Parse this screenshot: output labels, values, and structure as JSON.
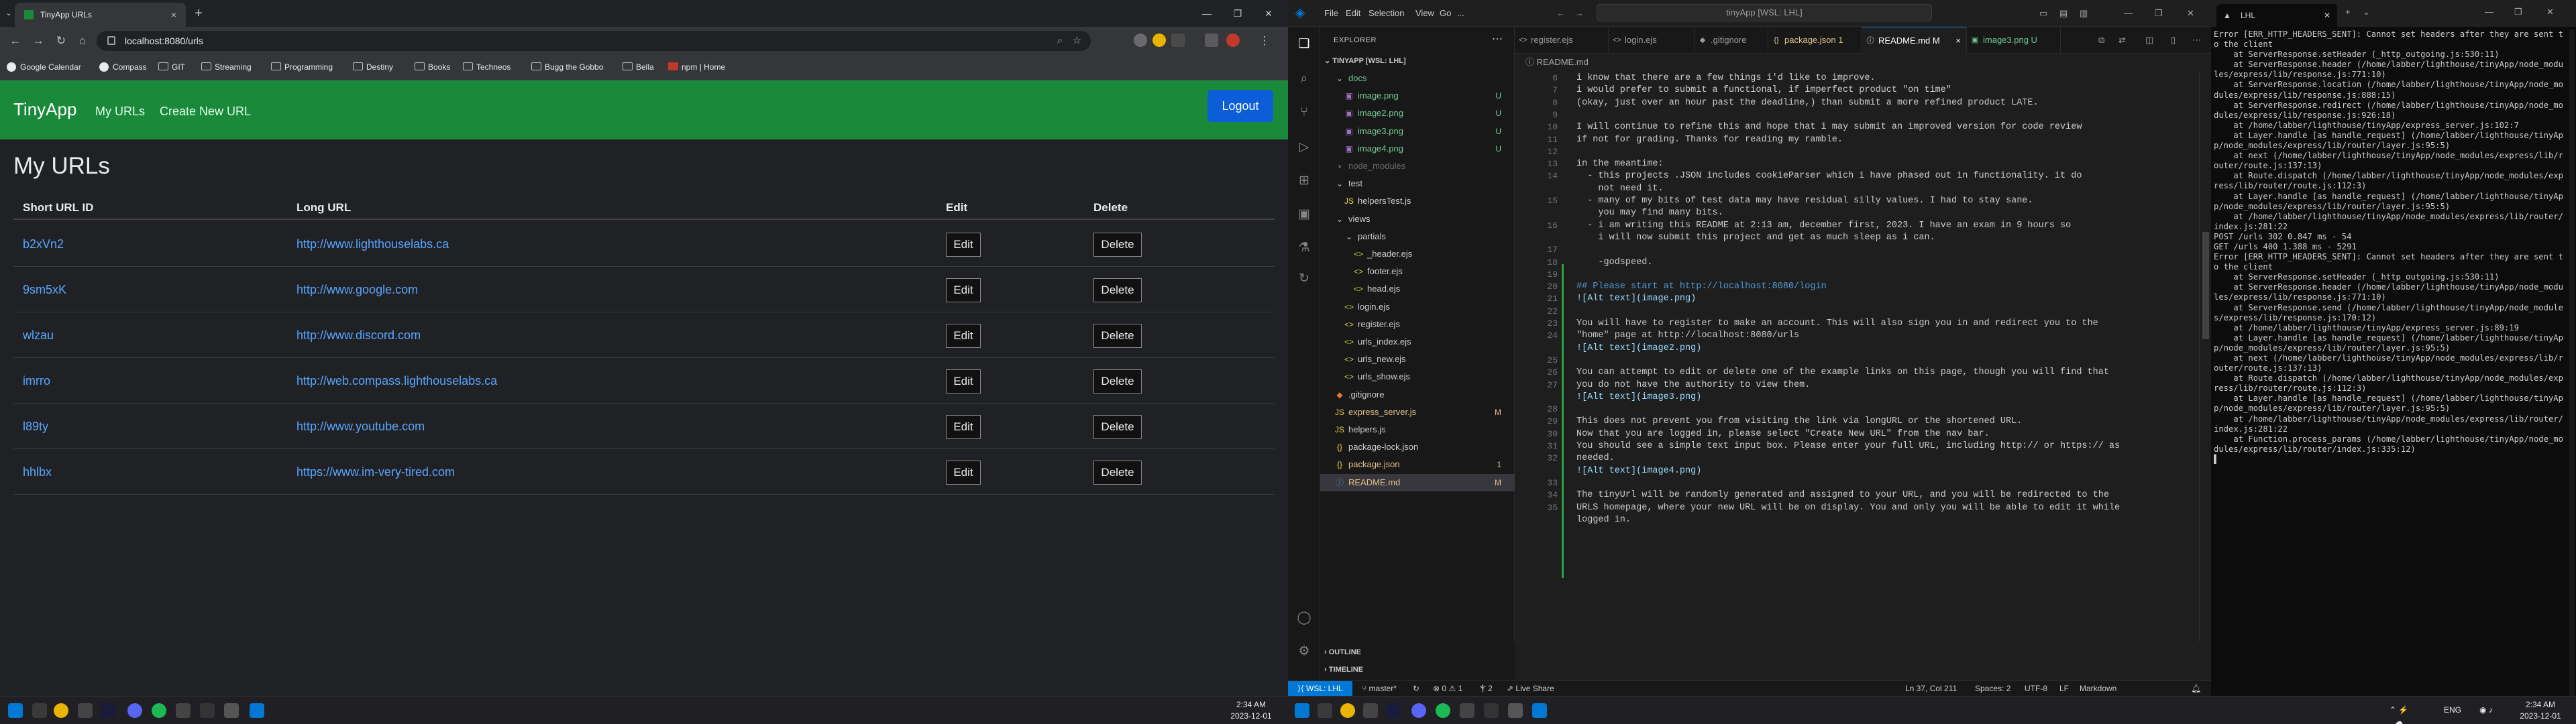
{
  "chrome": {
    "tab_title": "TinyApp URLs",
    "tab_close": "×",
    "new_tab": "+",
    "url": "localhost:8080/urls",
    "bookmarks": [
      "Google Calendar",
      "Compass",
      "GIT",
      "Streaming",
      "Programming",
      "Destiny",
      "Books",
      "Techneos",
      "Bugg the Gobbo",
      "Bella",
      "npm | Home"
    ]
  },
  "tinyapp": {
    "brand": "TinyApp",
    "nav_my_urls": "My URLs",
    "nav_create": "Create New URL",
    "logout": "Logout",
    "heading": "My URLs",
    "col_short": "Short URL ID",
    "col_long": "Long URL",
    "col_edit": "Edit",
    "col_delete": "Delete",
    "edit_label": "Edit",
    "delete_label": "Delete",
    "rows": [
      {
        "id": "b2xVn2",
        "long": "http://www.lighthouselabs.ca"
      },
      {
        "id": "9sm5xK",
        "long": "http://www.google.com"
      },
      {
        "id": "wlzau",
        "long": "http://www.discord.com"
      },
      {
        "id": "imrro",
        "long": "http://web.compass.lighthouselabs.ca"
      },
      {
        "id": "l89ty",
        "long": "http://www.youtube.com"
      },
      {
        "id": "hhlbx",
        "long": "https://www.im-very-tired.com"
      }
    ]
  },
  "taskbar": {
    "left_time": "2:34 AM",
    "left_date": "2023-12-01",
    "right_lang": "ENG",
    "right_time": "2:34 AM",
    "right_date": "2023-12-01"
  },
  "vscode": {
    "menus": [
      "File",
      "Edit",
      "Selection",
      "View",
      "Go",
      "..."
    ],
    "search": "tinyApp [WSL: LHL]",
    "explorer_label": "EXPLORER",
    "root": "TINYAPP [WSL: LHL]",
    "tree": [
      {
        "name": "docs",
        "kind": "folder",
        "badge": "",
        "indent": 1,
        "color": "#73c991"
      },
      {
        "name": "image.png",
        "kind": "img",
        "badge": "U",
        "indent": 2,
        "color": "#73c991"
      },
      {
        "name": "image2.png",
        "kind": "img",
        "badge": "U",
        "indent": 2,
        "color": "#73c991"
      },
      {
        "name": "image3.png",
        "kind": "img",
        "badge": "U",
        "indent": 2,
        "color": "#73c991"
      },
      {
        "name": "image4.png",
        "kind": "img",
        "badge": "U",
        "indent": 2,
        "color": "#73c991"
      },
      {
        "name": "node_modules",
        "kind": "folder",
        "badge": "",
        "indent": 1,
        "color": "#6b6b6b"
      },
      {
        "name": "test",
        "kind": "folder",
        "badge": "",
        "indent": 1,
        "color": "#cccccc"
      },
      {
        "name": "helpersTest.js",
        "kind": "js",
        "badge": "",
        "indent": 2,
        "color": "#cccccc"
      },
      {
        "name": "views",
        "kind": "folder",
        "badge": "",
        "indent": 1,
        "color": "#cccccc"
      },
      {
        "name": "partials",
        "kind": "folder",
        "badge": "",
        "indent": 2,
        "color": "#cccccc"
      },
      {
        "name": "_header.ejs",
        "kind": "ejs",
        "badge": "",
        "indent": 3,
        "color": "#cccccc"
      },
      {
        "name": "footer.ejs",
        "kind": "ejs",
        "badge": "",
        "indent": 3,
        "color": "#cccccc"
      },
      {
        "name": "head.ejs",
        "kind": "ejs",
        "badge": "",
        "indent": 3,
        "color": "#cccccc"
      },
      {
        "name": "login.ejs",
        "kind": "ejs",
        "badge": "",
        "indent": 2,
        "color": "#cccccc"
      },
      {
        "name": "register.ejs",
        "kind": "ejs",
        "badge": "",
        "indent": 2,
        "color": "#cccccc"
      },
      {
        "name": "urls_index.ejs",
        "kind": "ejs",
        "badge": "",
        "indent": 2,
        "color": "#cccccc"
      },
      {
        "name": "urls_new.ejs",
        "kind": "ejs",
        "badge": "",
        "indent": 2,
        "color": "#cccccc"
      },
      {
        "name": "urls_show.ejs",
        "kind": "ejs",
        "badge": "",
        "indent": 2,
        "color": "#cccccc"
      },
      {
        "name": ".gitignore",
        "kind": "git",
        "badge": "",
        "indent": 1,
        "color": "#cccccc"
      },
      {
        "name": "express_server.js",
        "kind": "js",
        "badge": "M",
        "indent": 1,
        "color": "#e2c08d"
      },
      {
        "name": "helpers.js",
        "kind": "js",
        "badge": "",
        "indent": 1,
        "color": "#cccccc"
      },
      {
        "name": "package-lock.json",
        "kind": "json",
        "badge": "",
        "indent": 1,
        "color": "#cccccc"
      },
      {
        "name": "package.json",
        "kind": "json",
        "badge": "1",
        "indent": 1,
        "color": "#e2c08d"
      },
      {
        "name": "README.md",
        "kind": "md",
        "badge": "M",
        "indent": 1,
        "color": "#e2c08d"
      }
    ],
    "tabs": [
      {
        "name": "register.ejs",
        "icon": "<>",
        "color": "#9d9d9d"
      },
      {
        "name": "login.ejs",
        "icon": "<>",
        "color": "#9d9d9d"
      },
      {
        "name": ".gitignore",
        "icon": "◆",
        "color": "#9d9d9d"
      },
      {
        "name": "package.json 1",
        "icon": "{}",
        "color": "#e2c08d"
      },
      {
        "name": "README.md M",
        "icon": "ⓘ",
        "color": "#ffffff"
      },
      {
        "name": "image3.png U",
        "icon": "▣",
        "color": "#73c991"
      }
    ],
    "tab_close": "×",
    "breadcrumb": "ⓘ README.md",
    "code_start_line": 6,
    "code": [
      {
        "t": "i know that there are a few things i'd like to improve.",
        "c": "u"
      },
      {
        "t": "i would prefer to submit a functional, if imperfect product \"on time\"",
        "c": "u"
      },
      {
        "t": "(okay, just over an hour past the deadline,) than submit a more refined product LATE.",
        "c": "u"
      },
      {
        "t": "",
        "c": "u"
      },
      {
        "t": "I will continue to refine this and hope that i may submit an improved version for code review",
        "c": "u"
      },
      {
        "t": "if not for grading. Thanks for reading my ramble.",
        "c": "u"
      },
      {
        "t": "",
        "c": "u"
      },
      {
        "t": "in the meantime:",
        "c": "u"
      },
      {
        "t": "  - this projects .JSON includes cookieParser which i have phased out in functionality. it do",
        "c": "u"
      },
      {
        "t": "    not need it.",
        "c": "u"
      },
      {
        "t": "  - many of my bits of test data may have residual silly values. I had to stay sane.",
        "c": "u"
      },
      {
        "t": "    you may find many bits.",
        "c": "u"
      },
      {
        "t": "  - i am writing this README at 2:13 am, december first, 2023. I have an exam in 9 hours so",
        "c": "u"
      },
      {
        "t": "    i will now submit this project and get as much sleep as i can.",
        "c": "u"
      },
      {
        "t": "",
        "c": "u"
      },
      {
        "t": "    -godspeed.",
        "c": "u"
      },
      {
        "t": "",
        "c": "u"
      },
      {
        "t": "## Please start at http://localhost:8080/login",
        "c": "h"
      },
      {
        "t": "![Alt text](image.png)",
        "c": "lk"
      },
      {
        "t": "",
        "c": "u"
      },
      {
        "t": "You will have to register to make an account. This will also sign you in and redirect you to the",
        "c": "u"
      },
      {
        "t": "\"home\" page at http://localhost:8080/urls",
        "c": "u"
      },
      {
        "t": "![Alt text](image2.png)",
        "c": "lk"
      },
      {
        "t": "",
        "c": "u"
      },
      {
        "t": "You can attempt to edit or delete one of the example links on this page, though you will find that",
        "c": "u"
      },
      {
        "t": "you do not have the authority to view them.",
        "c": "u"
      },
      {
        "t": "![Alt text](image3.png)",
        "c": "lk"
      },
      {
        "t": "",
        "c": "u"
      },
      {
        "t": "This does not prevent you from visiting the link via longURL or the shortened URL.",
        "c": "u"
      },
      {
        "t": "Now that you are logged in, please select \"Create New URL\" from the nav bar.",
        "c": "u"
      },
      {
        "t": "You should see a simple text input box. Please enter your full URL, including http:// or https:// as",
        "c": "u"
      },
      {
        "t": "needed.",
        "c": "u"
      },
      {
        "t": "![Alt text](image4.png)",
        "c": "lk"
      },
      {
        "t": "",
        "c": "u"
      },
      {
        "t": "The tinyUrl will be randomly generated and assigned to your URL, and you will be redirected to the",
        "c": "u"
      },
      {
        "t": "URLS homepage, where your new URL will be on display. You and only you will be able to edit it while",
        "c": "u"
      },
      {
        "t": "logged in.",
        "c": "u"
      }
    ],
    "line_numbers": [
      "6",
      "7",
      "8",
      "9",
      "10",
      "11",
      "12",
      "13",
      "14",
      "",
      "15",
      "",
      "16",
      "",
      "17",
      "18",
      "19",
      "20",
      "21",
      "22",
      "23",
      "24",
      "",
      "25",
      "26",
      "27",
      "",
      "28",
      "29",
      "30",
      "31",
      "32",
      "",
      "33",
      "34",
      "35",
      "",
      "36"
    ],
    "outline": "OUTLINE",
    "timeline": "TIMELINE",
    "status": {
      "remote": "WSL: LHL",
      "branch": "master*",
      "problems": "⊗ 0 ⚠ 1",
      "ports": "Ⲯ 2",
      "liveshare": "Live Share",
      "position": "Ln 37, Col 211",
      "spaces": "Spaces: 2",
      "encoding": "UTF-8",
      "eol": "LF",
      "lang": "Markdown"
    }
  },
  "terminal": {
    "tab_title": "LHL",
    "lines": [
      "Error [ERR_HTTP_HEADERS_SENT]: Cannot set headers after they are sent to the client",
      "    at ServerResponse.setHeader (_http_outgoing.js:530:11)",
      "    at ServerResponse.header (/home/labber/lighthouse/tinyApp/node_modules/express/lib/response.js:771:10)",
      "    at ServerResponse.location (/home/labber/lighthouse/tinyApp/node_modules/express/lib/response.js:888:15)",
      "    at ServerResponse.redirect (/home/labber/lighthouse/tinyApp/node_modules/express/lib/response.js:926:18)",
      "    at /home/labber/lighthouse/tinyApp/express_server.js:102:7",
      "    at Layer.handle [as handle_request] (/home/labber/lighthouse/tinyApp/node_modules/express/lib/router/layer.js:95:5)",
      "    at next (/home/labber/lighthouse/tinyApp/node_modules/express/lib/router/route.js:137:13)",
      "    at Route.dispatch (/home/labber/lighthouse/tinyApp/node_modules/express/lib/router/route.js:112:3)",
      "    at Layer.handle [as handle_request] (/home/labber/lighthouse/tinyApp/node_modules/express/lib/router/layer.js:95:5)",
      "    at /home/labber/lighthouse/tinyApp/node_modules/express/lib/router/index.js:281:22",
      "POST /urls 302 0.847 ms - 54",
      "GET /urls 400 1.388 ms - 5291",
      "Error [ERR_HTTP_HEADERS_SENT]: Cannot set headers after they are sent to the client",
      "    at ServerResponse.setHeader (_http_outgoing.js:530:11)",
      "    at ServerResponse.header (/home/labber/lighthouse/tinyApp/node_modules/express/lib/response.js:771:10)",
      "    at ServerResponse.send (/home/labber/lighthouse/tinyApp/node_modules/express/lib/response.js:170:12)",
      "    at /home/labber/lighthouse/tinyApp/express_server.js:89:19",
      "    at Layer.handle [as handle_request] (/home/labber/lighthouse/tinyApp/node_modules/express/lib/router/layer.js:95:5)",
      "    at next (/home/labber/lighthouse/tinyApp/node_modules/express/lib/router/route.js:137:13)",
      "    at Route.dispatch (/home/labber/lighthouse/tinyApp/node_modules/express/lib/router/route.js:112:3)",
      "    at Layer.handle [as handle_request] (/home/labber/lighthouse/tinyApp/node_modules/express/lib/router/layer.js:95:5)",
      "    at /home/labber/lighthouse/tinyApp/node_modules/express/lib/router/index.js:281:22",
      "    at Function.process_params (/home/labber/lighthouse/tinyApp/node_modules/express/lib/router/index.js:335:12)",
      "▌"
    ]
  }
}
